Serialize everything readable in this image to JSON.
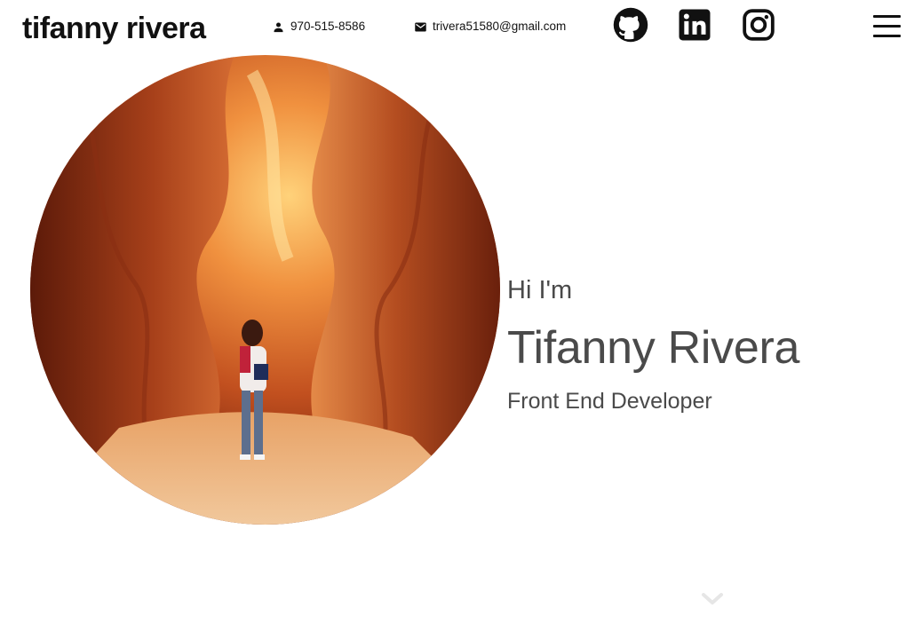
{
  "header": {
    "brand": "tifanny rivera",
    "phone": {
      "icon": "person-icon",
      "text": "970-515-8586"
    },
    "email": {
      "icon": "mail-icon",
      "text": "trivera51580@gmail.com"
    },
    "social": [
      {
        "icon": "github-icon"
      },
      {
        "icon": "linkedin-icon"
      },
      {
        "icon": "instagram-icon"
      }
    ],
    "menu_icon": "hamburger-menu-icon"
  },
  "hero": {
    "greeting": "Hi I'm",
    "name": "Tifanny Rivera",
    "role": "Front End Developer",
    "scroll_icon": "chevron-down-icon"
  },
  "colors": {
    "text_dark": "#111111",
    "text_muted": "#4a4a4a",
    "canyon_orange": "#d0622a",
    "canyon_deep": "#6e1f0c",
    "scroll_chevron": "#e6e6e6"
  }
}
